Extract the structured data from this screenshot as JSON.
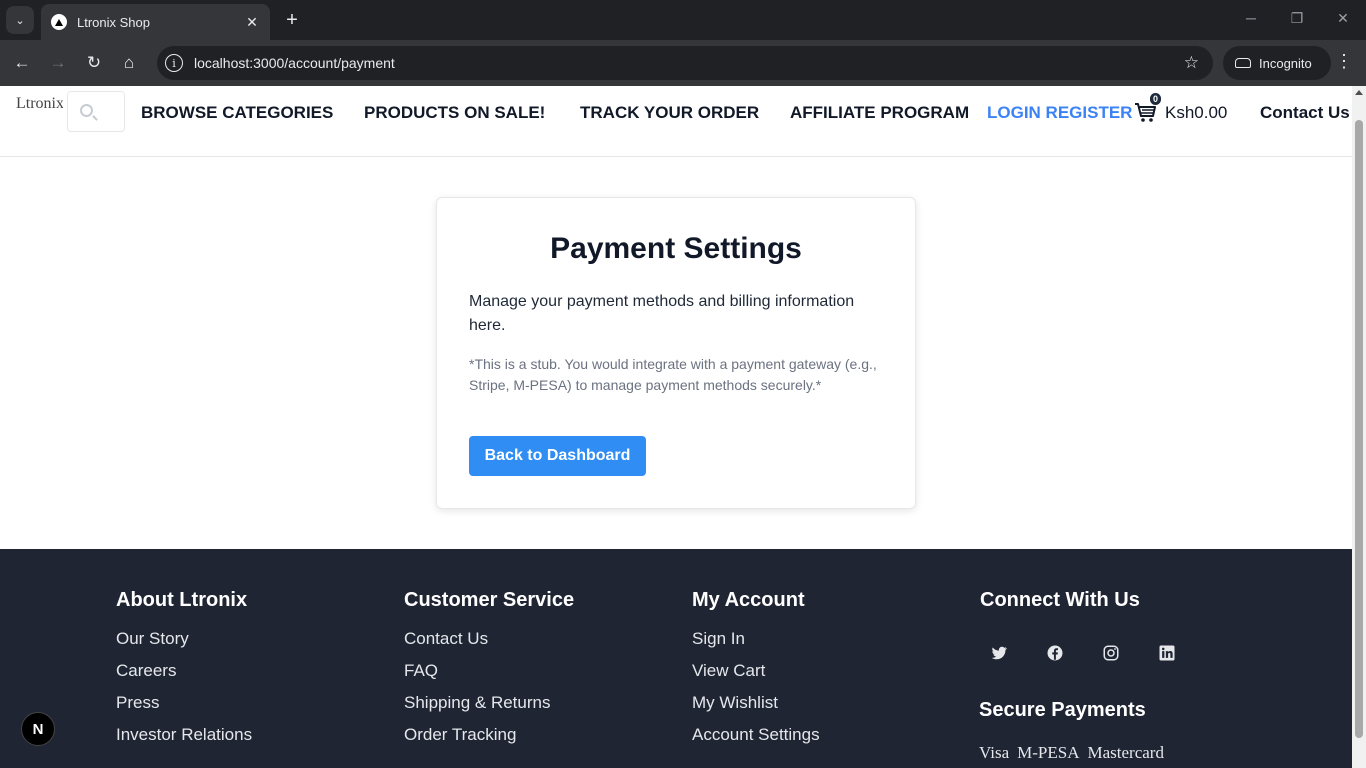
{
  "browser": {
    "tab_title": "Ltronix Shop",
    "url": "localhost:3000/account/payment",
    "profile_label": "Incognito"
  },
  "header": {
    "logo_alt": "Ltronix",
    "nav": [
      "BROWSE CATEGORIES",
      "PRODUCTS ON SALE!",
      "TRACK YOUR ORDER",
      "AFFILIATE PROGRAM"
    ],
    "login_label": "LOGIN REGISTER",
    "cart_count": "0",
    "cart_total": "Ksh0.00",
    "contact_label": "Contact Us"
  },
  "card": {
    "title": "Payment Settings",
    "description": "Manage your payment methods and billing information here.",
    "note": "*This is a stub. You would integrate with a payment gateway (e.g., Stripe, M-PESA) to manage payment methods securely.*",
    "button_label": "Back to Dashboard"
  },
  "footer": {
    "about": {
      "title": "About Ltronix",
      "links": [
        "Our Story",
        "Careers",
        "Press",
        "Investor Relations"
      ]
    },
    "service": {
      "title": "Customer Service",
      "links": [
        "Contact Us",
        "FAQ",
        "Shipping & Returns",
        "Order Tracking"
      ]
    },
    "account": {
      "title": "My Account",
      "links": [
        "Sign In",
        "View Cart",
        "My Wishlist",
        "Account Settings"
      ]
    },
    "connect": {
      "title": "Connect With Us",
      "icons": [
        "twitter-icon",
        "facebook-icon",
        "instagram-icon",
        "linkedin-icon"
      ]
    },
    "secure": {
      "title": "Secure Payments",
      "payment_alts": [
        "Visa",
        "M-PESA",
        "Mastercard"
      ]
    }
  },
  "colors": {
    "accent": "#2f8df3",
    "login_link": "#3b82f6",
    "footer_bg": "#1f2533"
  }
}
